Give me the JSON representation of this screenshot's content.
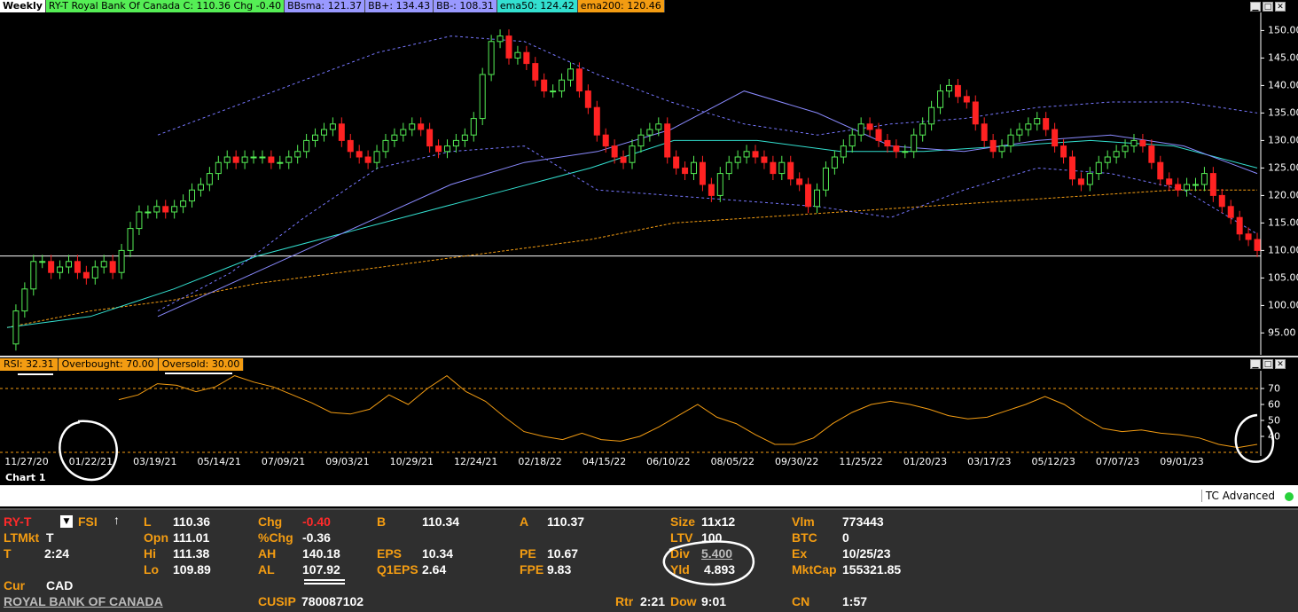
{
  "legend": {
    "period": "Weekly",
    "symbol": "RY-T  Royal Bank Of Canada  C: 110.36  Chg -0.40",
    "bbsma": "BBsma: 121.37",
    "bbplus": "BB+: 134.43",
    "bbminus": "BB-: 108.31",
    "ema50": "ema50: 124.42",
    "ema200": "ema200: 120.46",
    "colors": {
      "period": "#ffffff",
      "symbol": "#55ee55",
      "bbsma": "#9999ff",
      "bbplus": "#9999ff",
      "bbminus": "#9999ff",
      "ema50": "#33e0d0",
      "ema200": "#f39c12"
    }
  },
  "rsi_legend": {
    "rsi": "RSI: 32.31",
    "overbought": "Overbought: 70.00",
    "oversold": "Oversold: 30.00"
  },
  "price_axis": [
    "150.00",
    "145.00",
    "140.00",
    "135.00",
    "130.00",
    "125.00",
    "120.00",
    "115.00",
    "110.00",
    "105.00",
    "100.00",
    "95.00"
  ],
  "rsi_axis": [
    "70",
    "60",
    "50",
    "40"
  ],
  "x_axis": [
    "11/27/20",
    "01/22/21",
    "03/19/21",
    "05/14/21",
    "07/09/21",
    "09/03/21",
    "10/29/21",
    "12/24/21",
    "02/18/22",
    "04/15/22",
    "06/10/22",
    "08/05/22",
    "09/30/22",
    "11/25/22",
    "01/20/23",
    "03/17/23",
    "05/12/23",
    "07/07/23",
    "09/01/23"
  ],
  "tab": "Chart 1",
  "status": "TC Advanced",
  "quote": {
    "symbol": "RY-T",
    "fsi": "FSI",
    "ltmkt_label": "LTMkt",
    "ltmkt": "T",
    "t_label": "T",
    "t": "2:24",
    "cur_label": "Cur",
    "cur": "CAD",
    "name": "ROYAL BANK OF CANADA",
    "l_label": "L",
    "l": "110.36",
    "opn_label": "Opn",
    "opn": "111.01",
    "hi_label": "Hi",
    "hi": "111.38",
    "lo_label": "Lo",
    "lo": "109.89",
    "chg_label": "Chg",
    "chg": "-0.40",
    "pchg_label": "%Chg",
    "pchg": "-0.36",
    "ah_label": "AH",
    "ah": "140.18",
    "al_label": "AL",
    "al": "107.92",
    "cusip_label": "CUSIP",
    "cusip": "780087102",
    "b_label": "B",
    "b": "110.34",
    "eps_label": "EPS",
    "eps": "10.34",
    "q1eps_label": "Q1EPS",
    "q1eps": "2.64",
    "a_label": "A",
    "a": "110.37",
    "pe_label": "PE",
    "pe": "10.67",
    "fpe_label": "FPE",
    "fpe": "9.83",
    "rtr_label": "Rtr",
    "rtr": "2:21",
    "dow_label": "Dow",
    "dow": "9:01",
    "size_label": "Size",
    "size": "11x12",
    "ltv_label": "LTV",
    "ltv": "100",
    "div_label": "Div",
    "div": "5.400",
    "yld_label": "Yld",
    "yld": "4.893",
    "vlm_label": "Vlm",
    "vlm": "773443",
    "btc_label": "BTC",
    "btc": "0",
    "ex_label": "Ex",
    "ex": "10/25/23",
    "mktcap_label": "MktCap",
    "mktcap": "155321.85",
    "cn_label": "CN",
    "cn": "1:57"
  },
  "chart_data": {
    "type": "line",
    "title": "RY-T Royal Bank Of Canada Weekly",
    "ylim": [
      92,
      152
    ],
    "x_range": [
      "11/27/20",
      "11/03/23"
    ],
    "series": [
      {
        "name": "price",
        "values": [
          93,
          99,
          103,
          108,
          108,
          106,
          107,
          108,
          106,
          105,
          107,
          108,
          106,
          110,
          114,
          117,
          117,
          118,
          117,
          118,
          119,
          121,
          122,
          124,
          126,
          127,
          126,
          127,
          127,
          127,
          126,
          126,
          127,
          128,
          130,
          131,
          132,
          133,
          130,
          128,
          127,
          126,
          128,
          130,
          131,
          132,
          133,
          132,
          129,
          128,
          129,
          130,
          131,
          134,
          142,
          148,
          149,
          145,
          146,
          144,
          141,
          139,
          139,
          141,
          143,
          139,
          136,
          131,
          129,
          127,
          126,
          129,
          131,
          132,
          133,
          127,
          125,
          124,
          126,
          122,
          120,
          124,
          126,
          127,
          128,
          127,
          126,
          124,
          126,
          123,
          122,
          118,
          121,
          125,
          127,
          129,
          131,
          133,
          132,
          130,
          129,
          128,
          128,
          131,
          133,
          136,
          139,
          140,
          138,
          137,
          133,
          130,
          128,
          129,
          131,
          132,
          133,
          134,
          132,
          129,
          127,
          123,
          122,
          124,
          126,
          127,
          128,
          129,
          130,
          129,
          126,
          123,
          122,
          121,
          122,
          122,
          124,
          120,
          118,
          116,
          113,
          112,
          110
        ]
      },
      {
        "name": "BB+",
        "values": [
          131,
          136,
          141,
          146,
          149,
          148,
          142,
          137,
          133,
          131,
          133,
          134,
          136,
          137,
          137,
          135
        ]
      },
      {
        "name": "BBsma",
        "values": [
          98,
          104,
          110,
          116,
          122,
          126,
          128,
          132,
          139,
          135,
          129,
          128,
          130,
          131,
          129,
          124
        ]
      },
      {
        "name": "BB-",
        "values": [
          99,
          106,
          116,
          125,
          128,
          129,
          121,
          120,
          119,
          118,
          116,
          121,
          125,
          124,
          121,
          113
        ]
      },
      {
        "name": "ema50",
        "values": [
          96,
          98,
          103,
          109,
          113,
          117,
          121,
          125,
          130,
          130,
          128,
          128,
          129,
          130,
          129,
          125
        ]
      },
      {
        "name": "ema200",
        "values": [
          96,
          99,
          101,
          104,
          106,
          108,
          110,
          112,
          115,
          116,
          117,
          118,
          119,
          120,
          121,
          121
        ]
      },
      {
        "name": "RSI",
        "values": [
          63,
          66,
          73,
          72,
          68,
          71,
          78,
          74,
          71,
          66,
          61,
          55,
          54,
          57,
          66,
          60,
          70,
          78,
          68,
          62,
          52,
          43,
          40,
          38,
          42,
          38,
          37,
          40,
          46,
          53,
          60,
          52,
          48,
          41,
          35,
          35,
          39,
          48,
          55,
          60,
          62,
          60,
          57,
          53,
          51,
          52,
          56,
          60,
          65,
          60,
          52,
          45,
          43,
          44,
          42,
          41,
          39,
          35,
          33,
          35
        ]
      }
    ],
    "horizontal_line": 109,
    "rsi_levels": {
      "overbought": 70,
      "oversold": 30
    }
  }
}
